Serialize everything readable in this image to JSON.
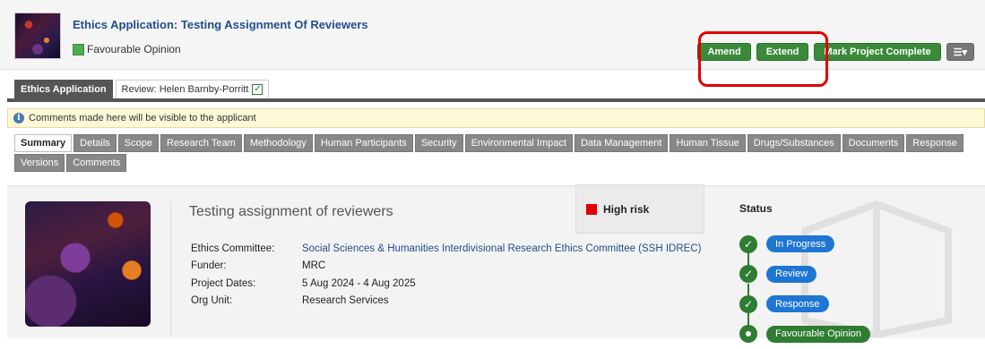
{
  "header": {
    "title": "Ethics Application: Testing Assignment Of Reviewers",
    "opinion_label": "Favourable Opinion",
    "opinion_color": "#4caf50",
    "buttons": {
      "amend": "Amend",
      "extend": "Extend",
      "complete": "Mark Project Complete",
      "menu": "☰▾"
    }
  },
  "top_tabs": [
    {
      "label": "Ethics Application"
    },
    {
      "label": "Review: Helen Barnby-Porritt"
    }
  ],
  "notice": {
    "text": "Comments made here will be visible to the applicant"
  },
  "subtabs": [
    "Summary",
    "Details",
    "Scope",
    "Research Team",
    "Methodology",
    "Human Participants",
    "Security",
    "Environmental Impact",
    "Data Management",
    "Human Tissue",
    "Drugs/Substances",
    "Documents",
    "Response",
    "Versions",
    "Comments"
  ],
  "summary": {
    "title": "Testing assignment of reviewers",
    "risk": {
      "label": "High risk",
      "color": "#e00000"
    },
    "fields": [
      {
        "label": "Ethics Committee:",
        "value": "Social Sciences & Humanities Interdivisional Research Ethics Committee (SSH IDREC)"
      },
      {
        "label": "Funder:",
        "value": "MRC"
      },
      {
        "label": "Project Dates:",
        "value": "5 Aug 2024 - 4 Aug 2025"
      },
      {
        "label": "Org Unit:",
        "value": "Research Services"
      }
    ]
  },
  "status": {
    "title": "Status",
    "steps": [
      {
        "label": "In Progress",
        "state": "done"
      },
      {
        "label": "Review",
        "state": "done"
      },
      {
        "label": "Response",
        "state": "done"
      },
      {
        "label": "Favourable Opinion",
        "state": "current"
      }
    ]
  }
}
